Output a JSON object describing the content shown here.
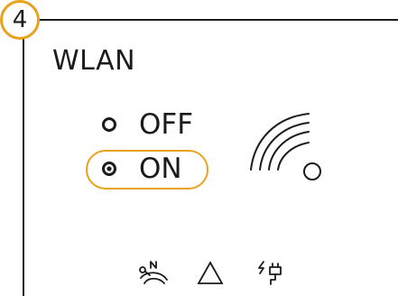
{
  "step": {
    "number": "4"
  },
  "screen": {
    "title": "WLAN",
    "options": [
      {
        "label": "OFF",
        "selected": false
      },
      {
        "label": "ON",
        "selected": true
      }
    ],
    "graphic_icon": "wifi-signal-icon",
    "bottom_icons": [
      "snooze-icon",
      "warning-triangle-icon",
      "power-plug-icon"
    ]
  },
  "colors": {
    "accent": "#e8a21b",
    "foreground": "#1b1b1b",
    "background": "#ffffff"
  }
}
